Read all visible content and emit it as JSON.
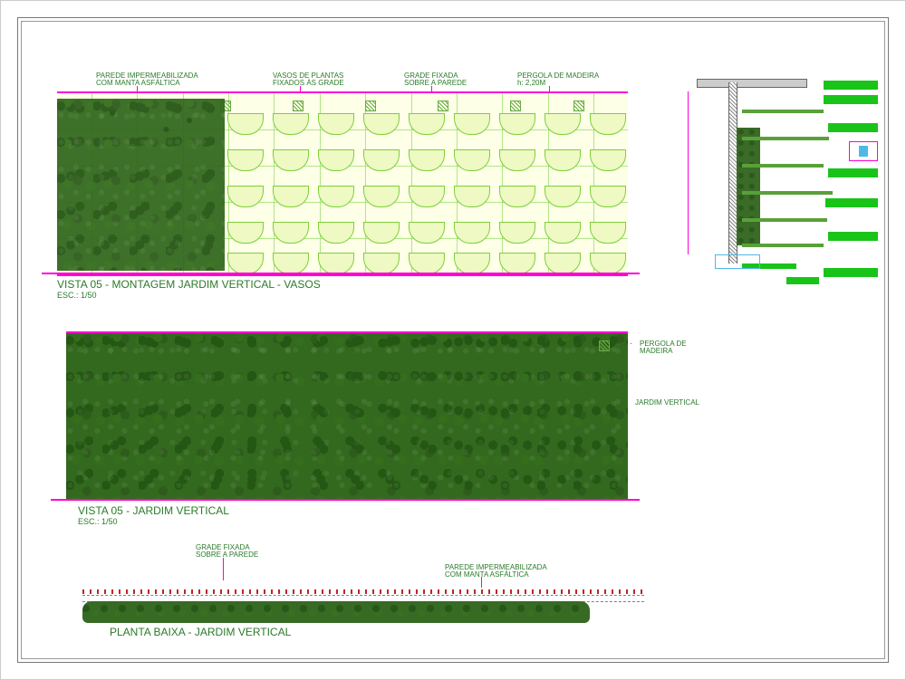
{
  "callouts_top": {
    "c1_l1": "PAREDE IMPERMEABILIZADA",
    "c1_l2": "COM MANTA ASFÁLTICA",
    "c2_l1": "VASOS DE PLANTAS",
    "c2_l2": "FIXADOS ÀS GRADE",
    "c3_l1": "GRADE FIXADA",
    "c3_l2": "SOBRE A PAREDE",
    "c4_l1": "PERGOLA DE MADEIRA",
    "c4_l2": "h: 2,20M"
  },
  "view1": {
    "title": "VISTA 05 - MONTAGEM JARDIM VERTICAL - VASOS",
    "scale": "ESC.: 1/50"
  },
  "view2": {
    "title": "VISTA 05 -  JARDIM VERTICAL",
    "scale": "ESC.: 1/50",
    "label_perg_l1": "PERGOLA DE",
    "label_perg_l2": "MADEIRA",
    "label_jardim": "JARDIM VERTICAL"
  },
  "view3": {
    "title": "PLANTA BAIXA - JARDIM VERTICAL",
    "c1_l1": "GRADE FIXADA",
    "c1_l2": "SOBRE A PAREDE",
    "c2_l1": "PAREDE IMPERMEABILIZADA",
    "c2_l2": "COM MANTA ASFÁLTICA"
  },
  "colors": {
    "magenta": "#ff00d6",
    "green": "#19c419",
    "dark_green": "#2c5a1e"
  }
}
